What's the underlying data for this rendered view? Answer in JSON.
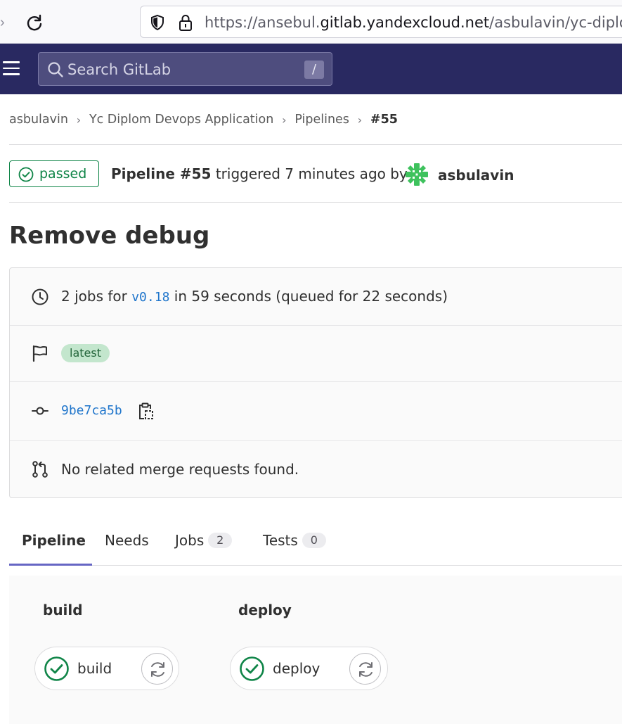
{
  "browser": {
    "url_prefix": "https://ansebul.",
    "url_domain": "gitlab.yandexcloud.net",
    "url_path": "/asbulavin/yc-diplom-"
  },
  "header": {
    "search_placeholder": "Search GitLab",
    "search_shortcut": "/"
  },
  "breadcrumb": {
    "items": [
      "asbulavin",
      "Yc Diplom Devops Application",
      "Pipelines"
    ],
    "current": "#55"
  },
  "pipeline": {
    "status": "passed",
    "name": "Pipeline #55",
    "triggered_text": "triggered 7 minutes ago by",
    "author": "asbulavin",
    "title": "Remove debug"
  },
  "info": {
    "jobs_prefix": "2 jobs for",
    "ref": "v0.18",
    "duration_text": "in 59 seconds (queued for 22 seconds)",
    "badge": "latest",
    "commit_sha": "9be7ca5b",
    "merge_requests_text": "No related merge requests found."
  },
  "tabs": [
    {
      "label": "Pipeline",
      "count": null,
      "active": true
    },
    {
      "label": "Needs",
      "count": null,
      "active": false
    },
    {
      "label": "Jobs",
      "count": "2",
      "active": false
    },
    {
      "label": "Tests",
      "count": "0",
      "active": false
    }
  ],
  "stages": [
    {
      "title": "build",
      "job": {
        "name": "build",
        "status": "success"
      }
    },
    {
      "title": "deploy",
      "job": {
        "name": "deploy",
        "status": "success"
      }
    }
  ],
  "colors": {
    "header_bg": "#292961",
    "success": "#108548",
    "link": "#1f75cb",
    "tab_active": "#6666c4"
  }
}
